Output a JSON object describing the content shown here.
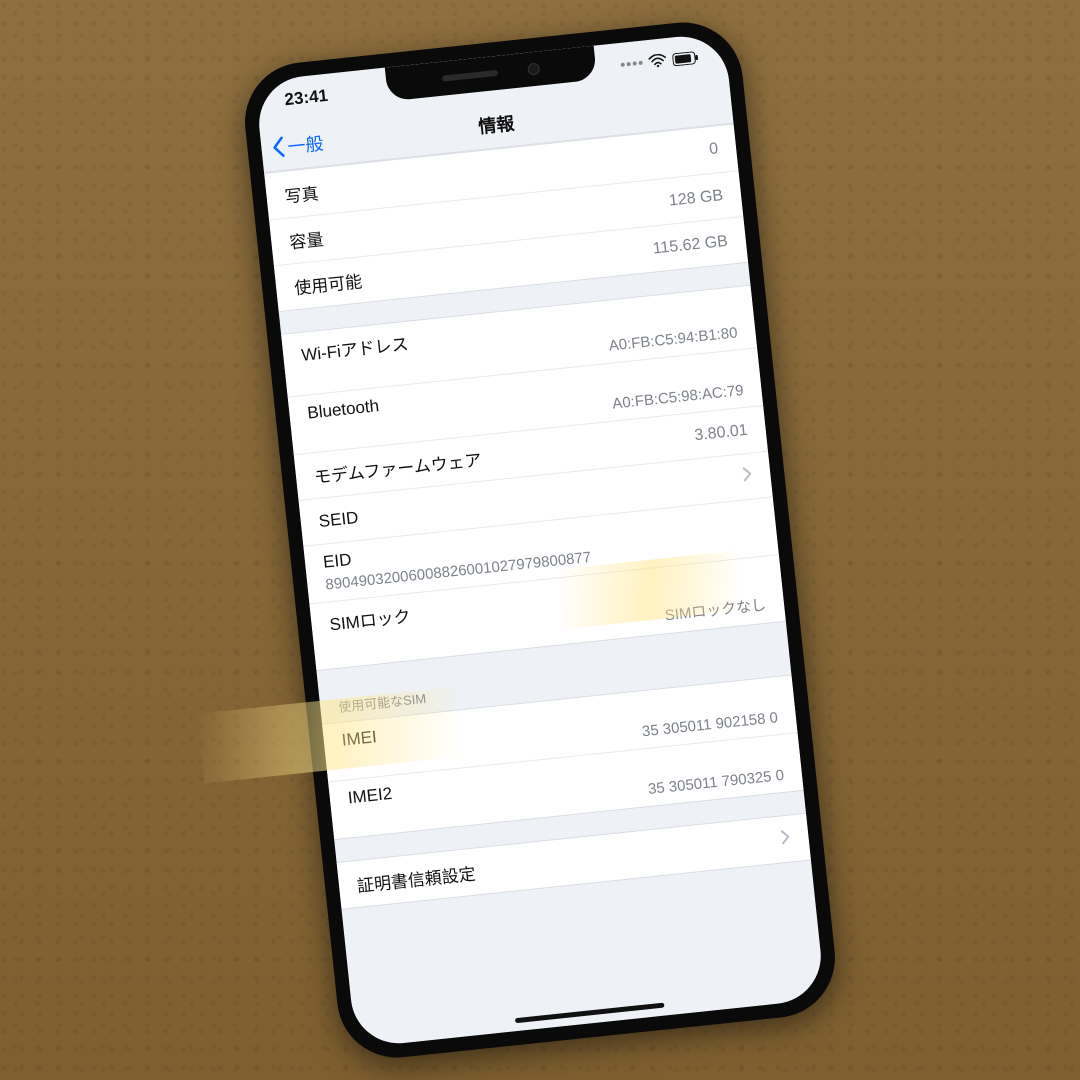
{
  "status": {
    "time": "23:41"
  },
  "nav": {
    "back_label": "一般",
    "title": "情報"
  },
  "group1": {
    "photos_label": "写真",
    "photos_value": "0",
    "capacity_label": "容量",
    "capacity_value": "128 GB",
    "available_label": "使用可能",
    "available_value": "115.62 GB"
  },
  "group2": {
    "wifi_label": "Wi-Fiアドレス",
    "wifi_value": "A0:FB:C5:94:B1:80",
    "bt_label": "Bluetooth",
    "bt_value": "A0:FB:C5:98:AC:79",
    "modem_label": "モデムファームウェア",
    "modem_value": "3.80.01",
    "seid_label": "SEID",
    "eid_label": "EID",
    "eid_value": "89049032006008826001027979800877",
    "simlock_label": "SIMロック",
    "simlock_value": "SIMロックなし"
  },
  "section_sim_header": "使用可能なSIM",
  "group3": {
    "imei_label": "IMEI",
    "imei_value": "35 305011 902158 0",
    "imei2_label": "IMEI2",
    "imei2_value": "35 305011 790325 0"
  },
  "group4": {
    "cert_label": "証明書信頼設定"
  }
}
